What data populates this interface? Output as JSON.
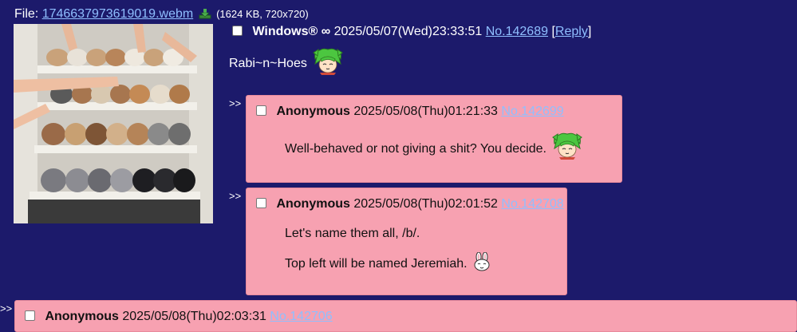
{
  "file": {
    "label": "File:",
    "filename": "1746637973619019.webm",
    "meta": "(1624 KB, 720x720)",
    "download_icon": "download-icon"
  },
  "op": {
    "name": "Windows® ∞",
    "datetime": "2025/05/07(Wed)23:33:51",
    "postno": "No.142689",
    "reply_open": "[",
    "reply_label": "Reply",
    "reply_close": "]",
    "comment": "Rabi~n~Hoes",
    "emote": "green-haired-girl-emote"
  },
  "replies": [
    {
      "arrows": ">>",
      "name": "Anonymous",
      "datetime": "2025/05/08(Thu)01:21:33",
      "postno": "No.142699",
      "lines": [
        "Well-behaved or not giving a shit? You decide."
      ],
      "emote": "green-haired-girl-emote"
    },
    {
      "arrows": ">>",
      "name": "Anonymous",
      "datetime": "2025/05/08(Thu)02:01:52",
      "postno": "No.142708",
      "lines": [
        "Let's name them all, /b/.",
        "Top left will be named Jeremiah."
      ],
      "emote": "bunny-emote"
    },
    {
      "arrows": ">>",
      "name": "Anonymous",
      "datetime": "2025/05/08(Thu)02:03:31",
      "postno": "No.142706"
    }
  ],
  "colors": {
    "background": "#1c1a6b",
    "reply_bg": "#f7a1b1",
    "link": "#8fbfff"
  }
}
